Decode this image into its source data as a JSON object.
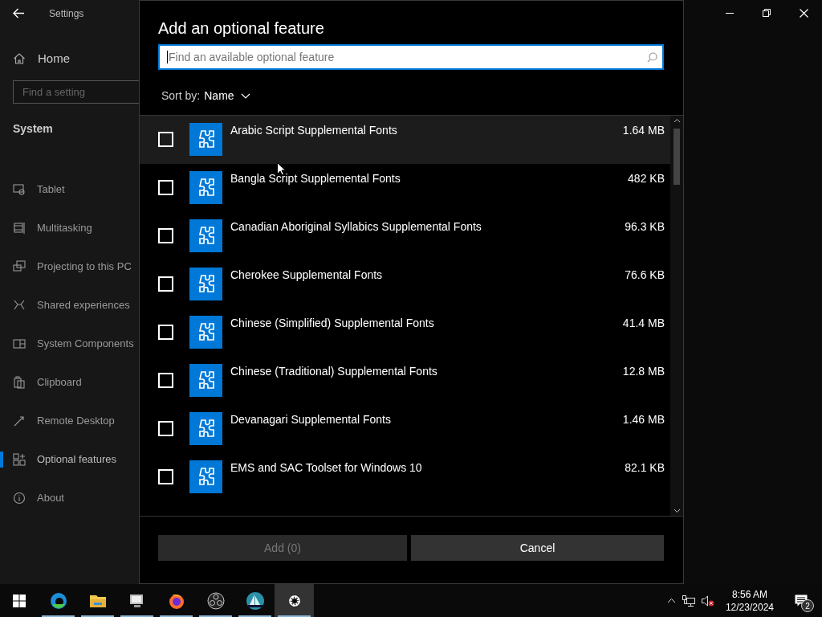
{
  "window": {
    "title": "Settings"
  },
  "sidebar": {
    "home": "Home",
    "search_placeholder": "Find a setting",
    "section": "System",
    "items": [
      {
        "label": "Tablet",
        "selected": false
      },
      {
        "label": "Multitasking",
        "selected": false
      },
      {
        "label": "Projecting to this PC",
        "selected": false
      },
      {
        "label": "Shared experiences",
        "selected": false
      },
      {
        "label": "System Components",
        "selected": false
      },
      {
        "label": "Clipboard",
        "selected": false
      },
      {
        "label": "Remote Desktop",
        "selected": false
      },
      {
        "label": "Optional features",
        "selected": true
      },
      {
        "label": "About",
        "selected": false
      }
    ]
  },
  "dialog": {
    "title": "Add an optional feature",
    "search": {
      "placeholder": "Find an available optional feature"
    },
    "sort_label": "Sort by:",
    "sort_value": "Name",
    "features": [
      {
        "name": "Arabic Script Supplemental Fonts",
        "size": "1.64 MB",
        "checked": false,
        "hovered": true
      },
      {
        "name": "Bangla Script Supplemental Fonts",
        "size": "482 KB",
        "checked": false,
        "hovered": false
      },
      {
        "name": "Canadian Aboriginal Syllabics Supplemental Fonts",
        "size": "96.3 KB",
        "checked": false,
        "hovered": false
      },
      {
        "name": "Cherokee Supplemental Fonts",
        "size": "76.6 KB",
        "checked": false,
        "hovered": false
      },
      {
        "name": "Chinese (Simplified) Supplemental Fonts",
        "size": "41.4 MB",
        "checked": false,
        "hovered": false
      },
      {
        "name": "Chinese (Traditional) Supplemental Fonts",
        "size": "12.8 MB",
        "checked": false,
        "hovered": false
      },
      {
        "name": "Devanagari Supplemental Fonts",
        "size": "1.46 MB",
        "checked": false,
        "hovered": false
      },
      {
        "name": "EMS and SAC Toolset for Windows 10",
        "size": "82.1 KB",
        "checked": false,
        "hovered": false
      }
    ],
    "buttons": [
      {
        "label": "Add (0)",
        "disabled": true
      },
      {
        "label": "Cancel",
        "disabled": false
      }
    ]
  },
  "taskbar": {
    "apps": [
      {
        "active": false
      },
      {
        "active": false
      },
      {
        "active": false
      },
      {
        "active": false
      },
      {
        "active": false
      },
      {
        "active": false
      },
      {
        "active": true
      }
    ],
    "time": "8:56 AM",
    "date": "12/23/2024",
    "notifications": "2"
  }
}
